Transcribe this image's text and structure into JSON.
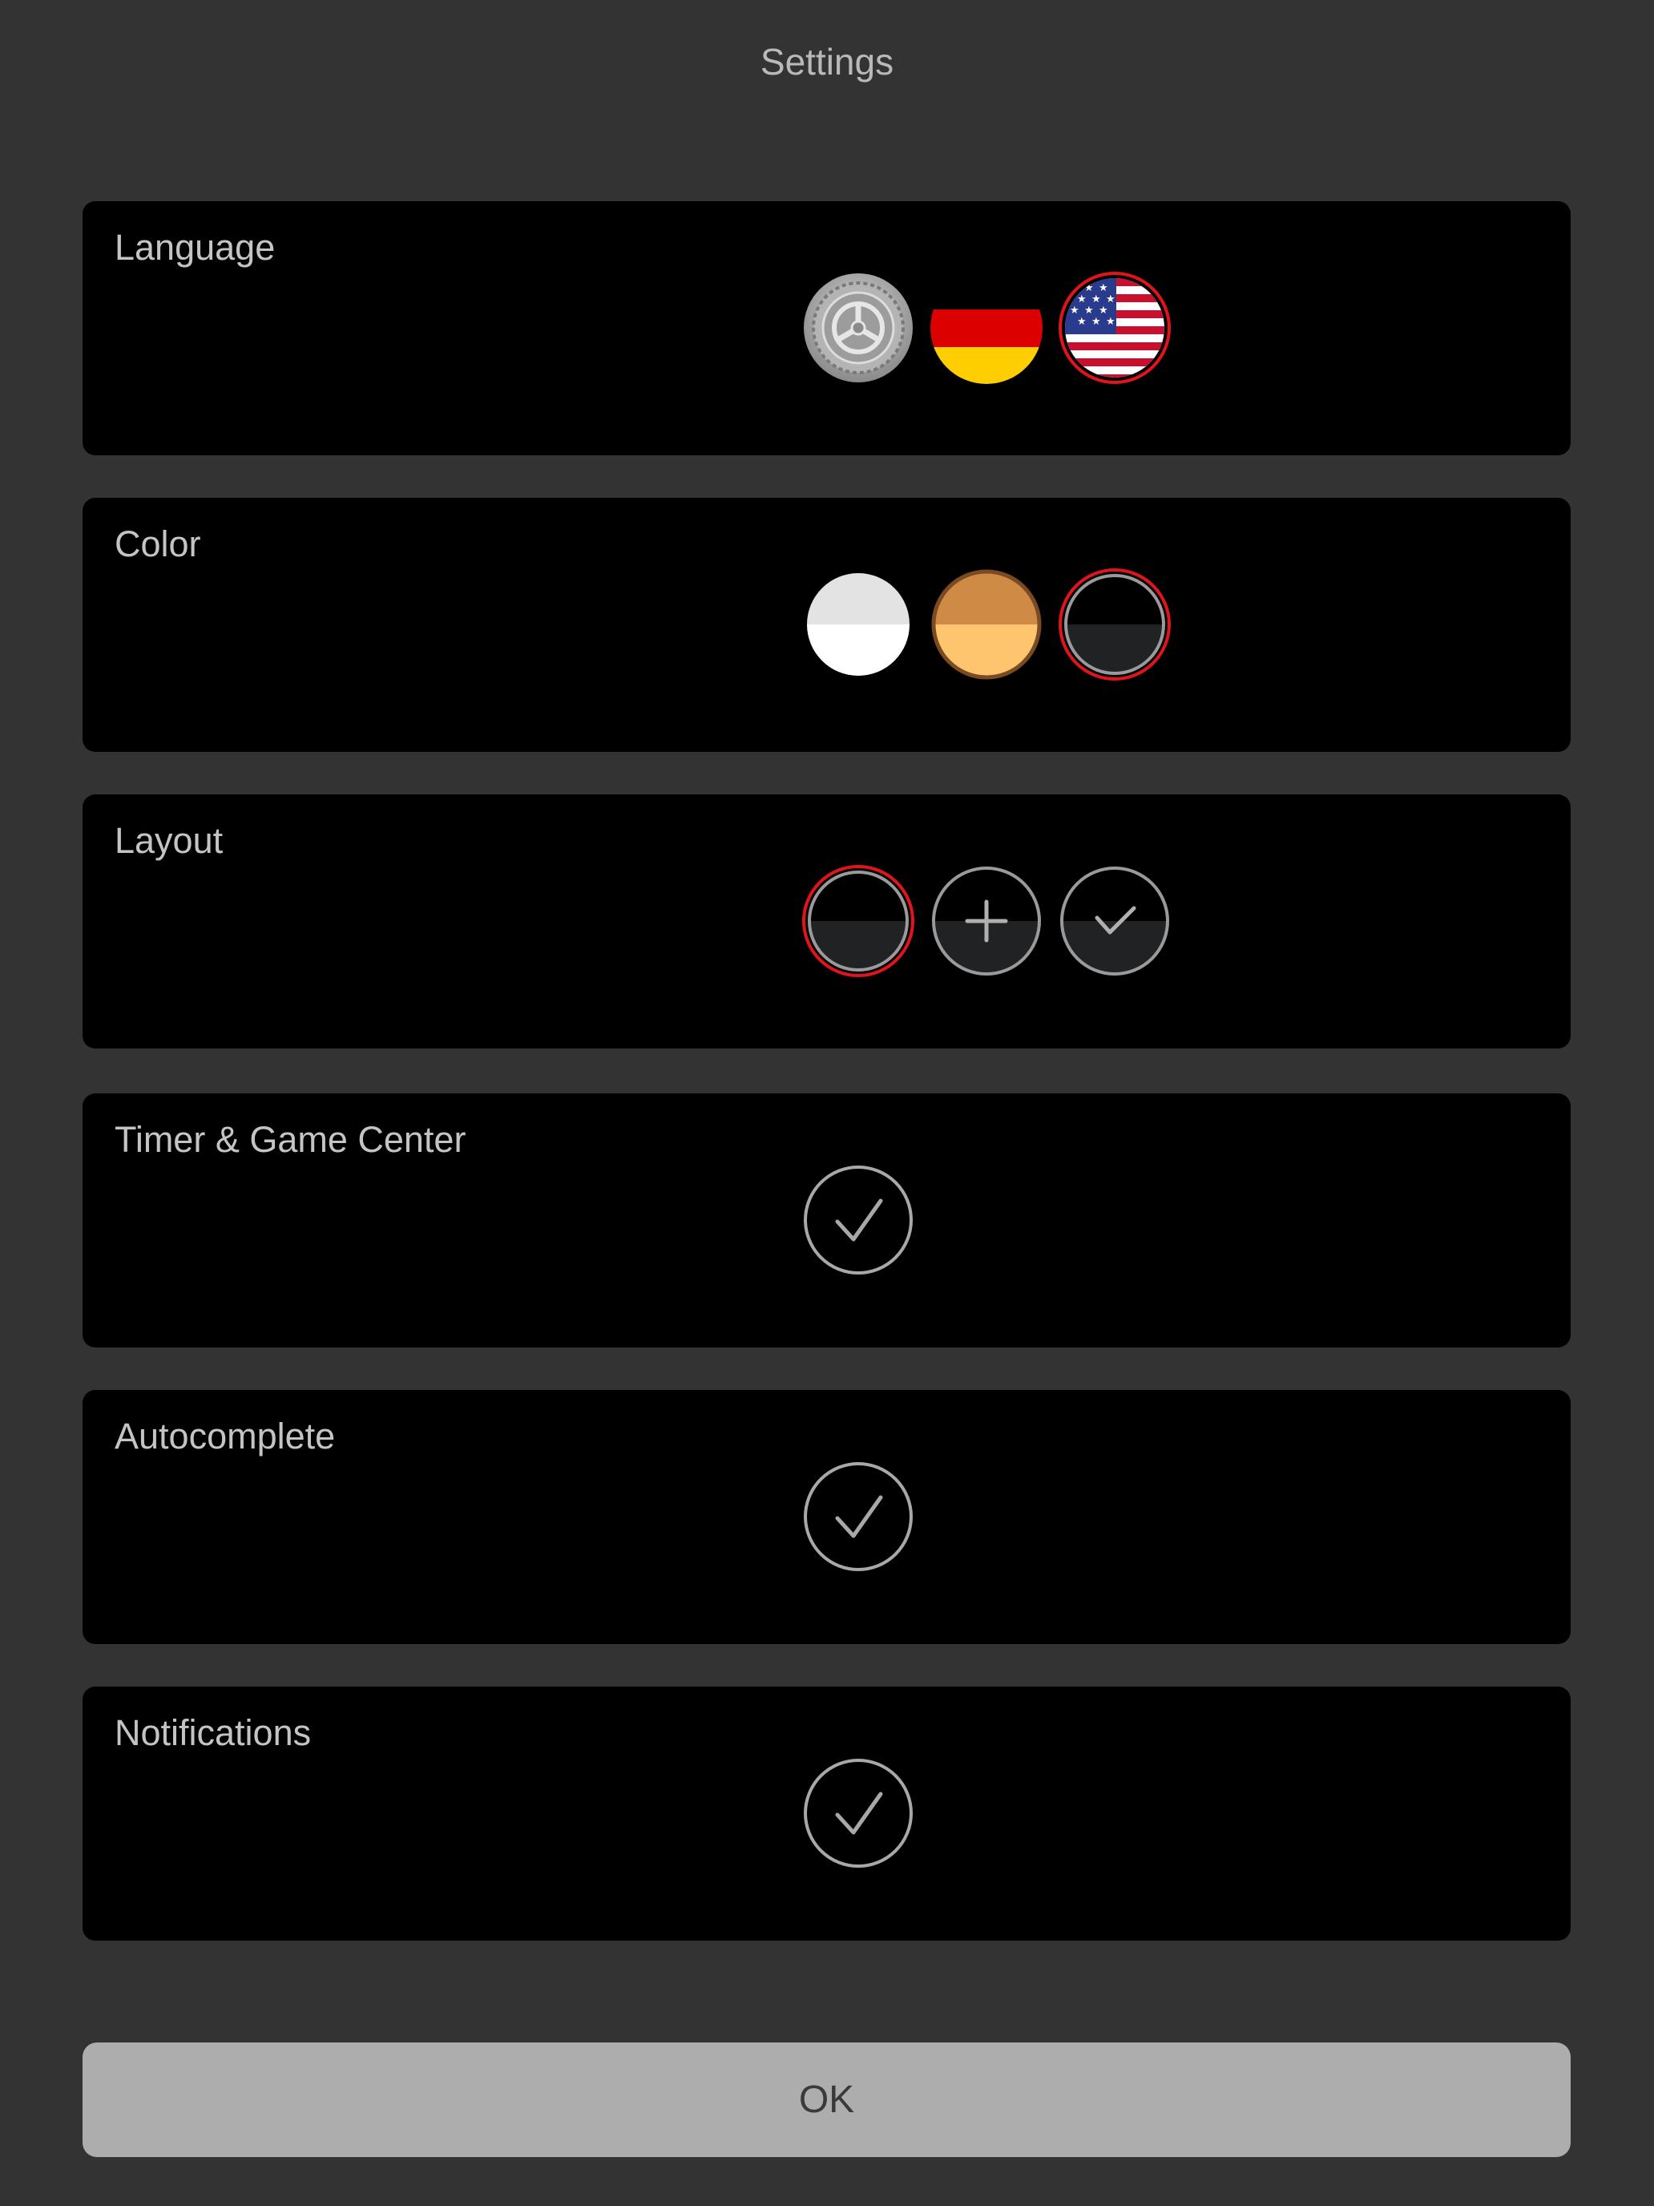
{
  "header": {
    "title": "Settings"
  },
  "sections": {
    "language": {
      "label": "Language",
      "options": [
        "system-gear-icon",
        "german-flag-icon",
        "us-flag-icon"
      ],
      "selected_index": 2
    },
    "color": {
      "label": "Color",
      "options": [
        "light-theme-swatch",
        "orange-theme-swatch",
        "dark-theme-swatch"
      ],
      "selected_index": 2
    },
    "layout": {
      "label": "Layout",
      "options": [
        "layout-plain-icon",
        "layout-plus-icon",
        "layout-check-icon"
      ],
      "selected_index": 0
    },
    "timer": {
      "label": "Timer & Game Center",
      "enabled": true
    },
    "autocomplete": {
      "label": "Autocomplete",
      "enabled": true
    },
    "notifications": {
      "label": "Notifications",
      "enabled": true
    }
  },
  "footer": {
    "ok_label": "OK"
  },
  "colors": {
    "background": "#333333",
    "card": "#000000",
    "text": "#c4c4c4",
    "selection_ring": "#e0141b",
    "button": "#adadad"
  }
}
